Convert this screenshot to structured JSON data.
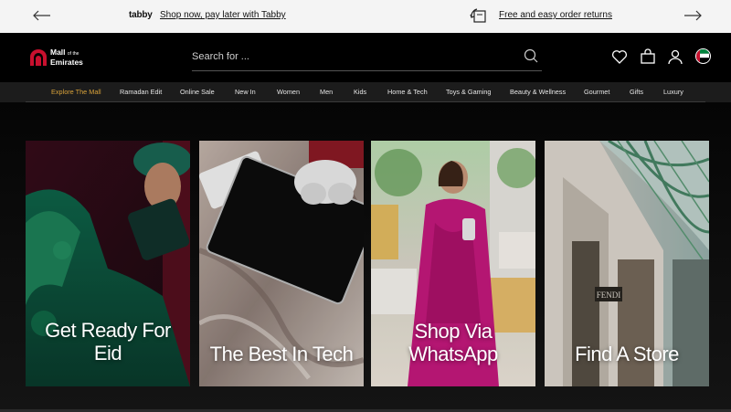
{
  "promo": {
    "tabby_logo": "tabby",
    "tabby_link": "Shop now, pay later with Tabby",
    "returns_link": "Free and easy order returns",
    "prev_icon": "arrow-left-icon",
    "next_icon": "arrow-right-icon"
  },
  "header": {
    "logo_line1": "Mall",
    "logo_of": "of the",
    "logo_line2": "Emirates",
    "search_placeholder": "Search for ...",
    "icons": [
      "search-icon",
      "heart-icon",
      "bag-icon",
      "user-icon",
      "uae-flag-icon"
    ]
  },
  "nav": {
    "items": [
      {
        "label": "Explore The Mall",
        "active": true
      },
      {
        "label": "Ramadan Edit"
      },
      {
        "label": "Online Sale"
      },
      {
        "label": "New In"
      },
      {
        "label": "Women"
      },
      {
        "label": "Men"
      },
      {
        "label": "Kids"
      },
      {
        "label": "Home & Tech"
      },
      {
        "label": "Toys & Gaming"
      },
      {
        "label": "Beauty & Wellness"
      },
      {
        "label": "Gourmet"
      },
      {
        "label": "Gifts"
      },
      {
        "label": "Luxury"
      }
    ]
  },
  "cards": [
    {
      "title_line1": "Get Ready For",
      "title_line2": "Eid"
    },
    {
      "title_line1": "The Best In Tech",
      "title_line2": ""
    },
    {
      "title_line1": "Shop Via",
      "title_line2": "WhatsApp"
    },
    {
      "title_line1": "Find A Store",
      "title_line2": ""
    }
  ],
  "colors": {
    "accent": "#d8a23a",
    "brand_red": "#c8102e",
    "nav_bg": "#1c1c1c",
    "promo_bg": "#f4f4f4"
  }
}
